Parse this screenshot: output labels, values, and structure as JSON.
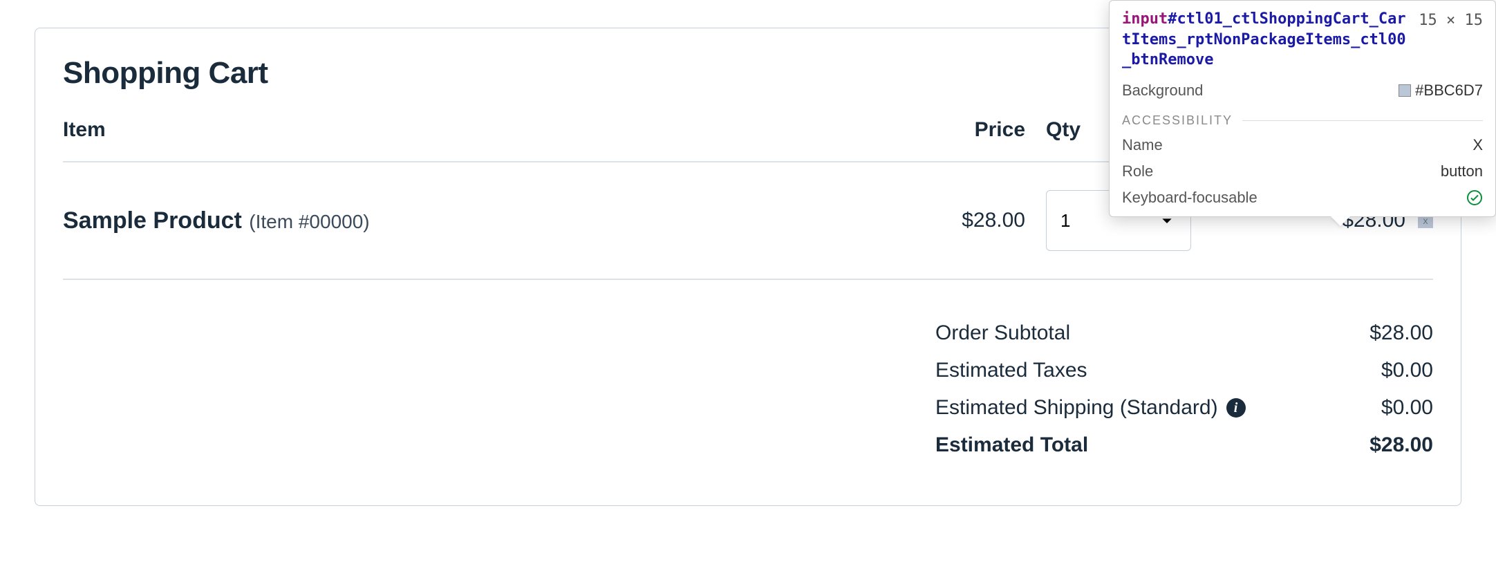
{
  "cart": {
    "title": "Shopping Cart",
    "headers": {
      "item": "Item",
      "price": "Price",
      "qty": "Qty"
    },
    "items": [
      {
        "name": "Sample Product",
        "number_label": "(Item #00000)",
        "price": "$28.00",
        "qty": "1",
        "total": "$28.00",
        "remove_label": "x"
      }
    ],
    "summary": {
      "subtotal_label": "Order Subtotal",
      "subtotal_value": "$28.00",
      "taxes_label": "Estimated Taxes",
      "taxes_value": "$0.00",
      "shipping_label": "Estimated Shipping (Standard)",
      "shipping_value": "$0.00",
      "total_label": "Estimated Total",
      "total_value": "$28.00"
    }
  },
  "inspect": {
    "selector_tag": "input",
    "selector_id": "#ctl01_ctlShoppingCart_CartItems_rptNonPackageItems_ctl00_btnRemove",
    "dims": "15 × 15",
    "background_label": "Background",
    "background_value": "#BBC6D7",
    "accessibility_label": "ACCESSIBILITY",
    "a11y_name_label": "Name",
    "a11y_name_value": "X",
    "a11y_role_label": "Role",
    "a11y_role_value": "button",
    "a11y_focus_label": "Keyboard-focusable"
  }
}
